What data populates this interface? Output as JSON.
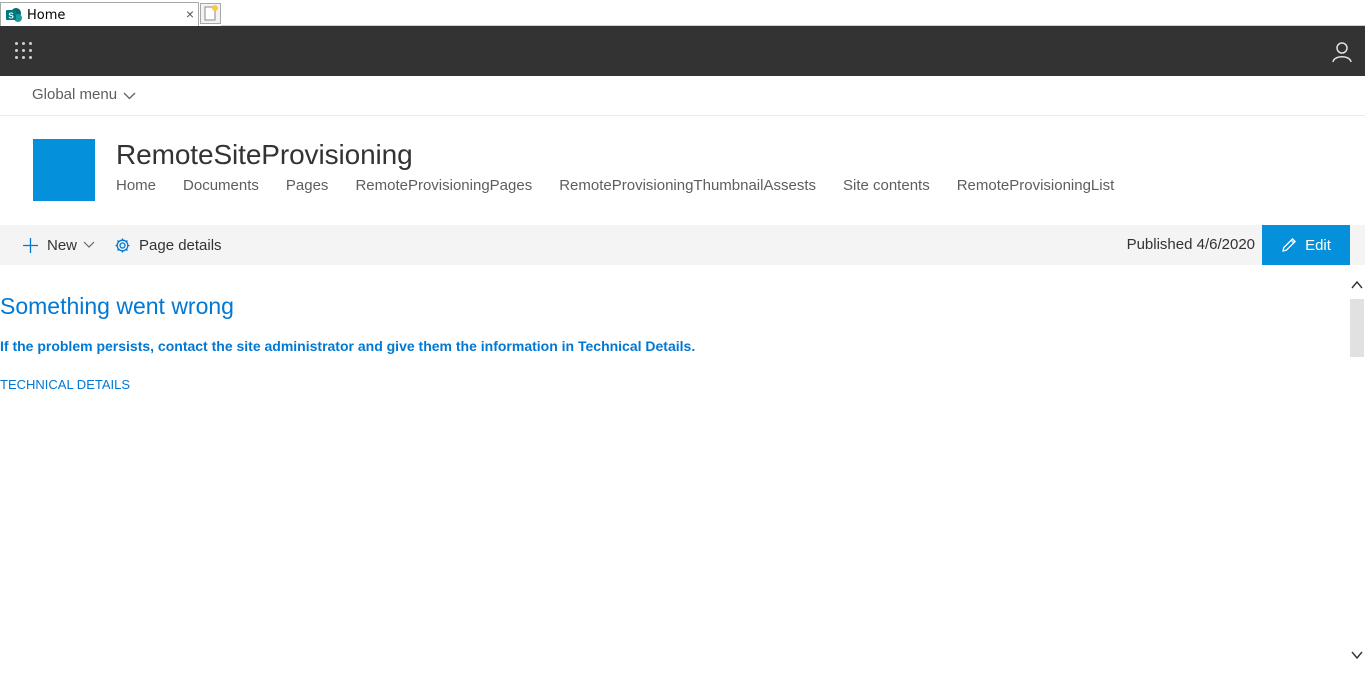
{
  "browser": {
    "tab_title": "Home",
    "tab_close": "×"
  },
  "global_nav": {
    "menu_label": "Global menu"
  },
  "site": {
    "title": "RemoteSiteProvisioning",
    "logo_color": "#0490db",
    "nav": [
      {
        "label": "Home"
      },
      {
        "label": "Documents"
      },
      {
        "label": "Pages"
      },
      {
        "label": "RemoteProvisioningPages"
      },
      {
        "label": "RemoteProvisioningThumbnailAssests"
      },
      {
        "label": "Site contents"
      },
      {
        "label": "RemoteProvisioningList"
      }
    ]
  },
  "command_bar": {
    "new_label": "New",
    "page_details_label": "Page details",
    "published_text": "Published 4/6/2020",
    "edit_label": "Edit"
  },
  "error": {
    "title": "Something went wrong",
    "message": "If the problem persists, contact the site administrator and give them the information in Technical Details.",
    "details_link": "TECHNICAL DETAILS"
  },
  "colors": {
    "suite_bar": "#333333",
    "accent": "#0490db",
    "error_text": "#0078d4"
  }
}
